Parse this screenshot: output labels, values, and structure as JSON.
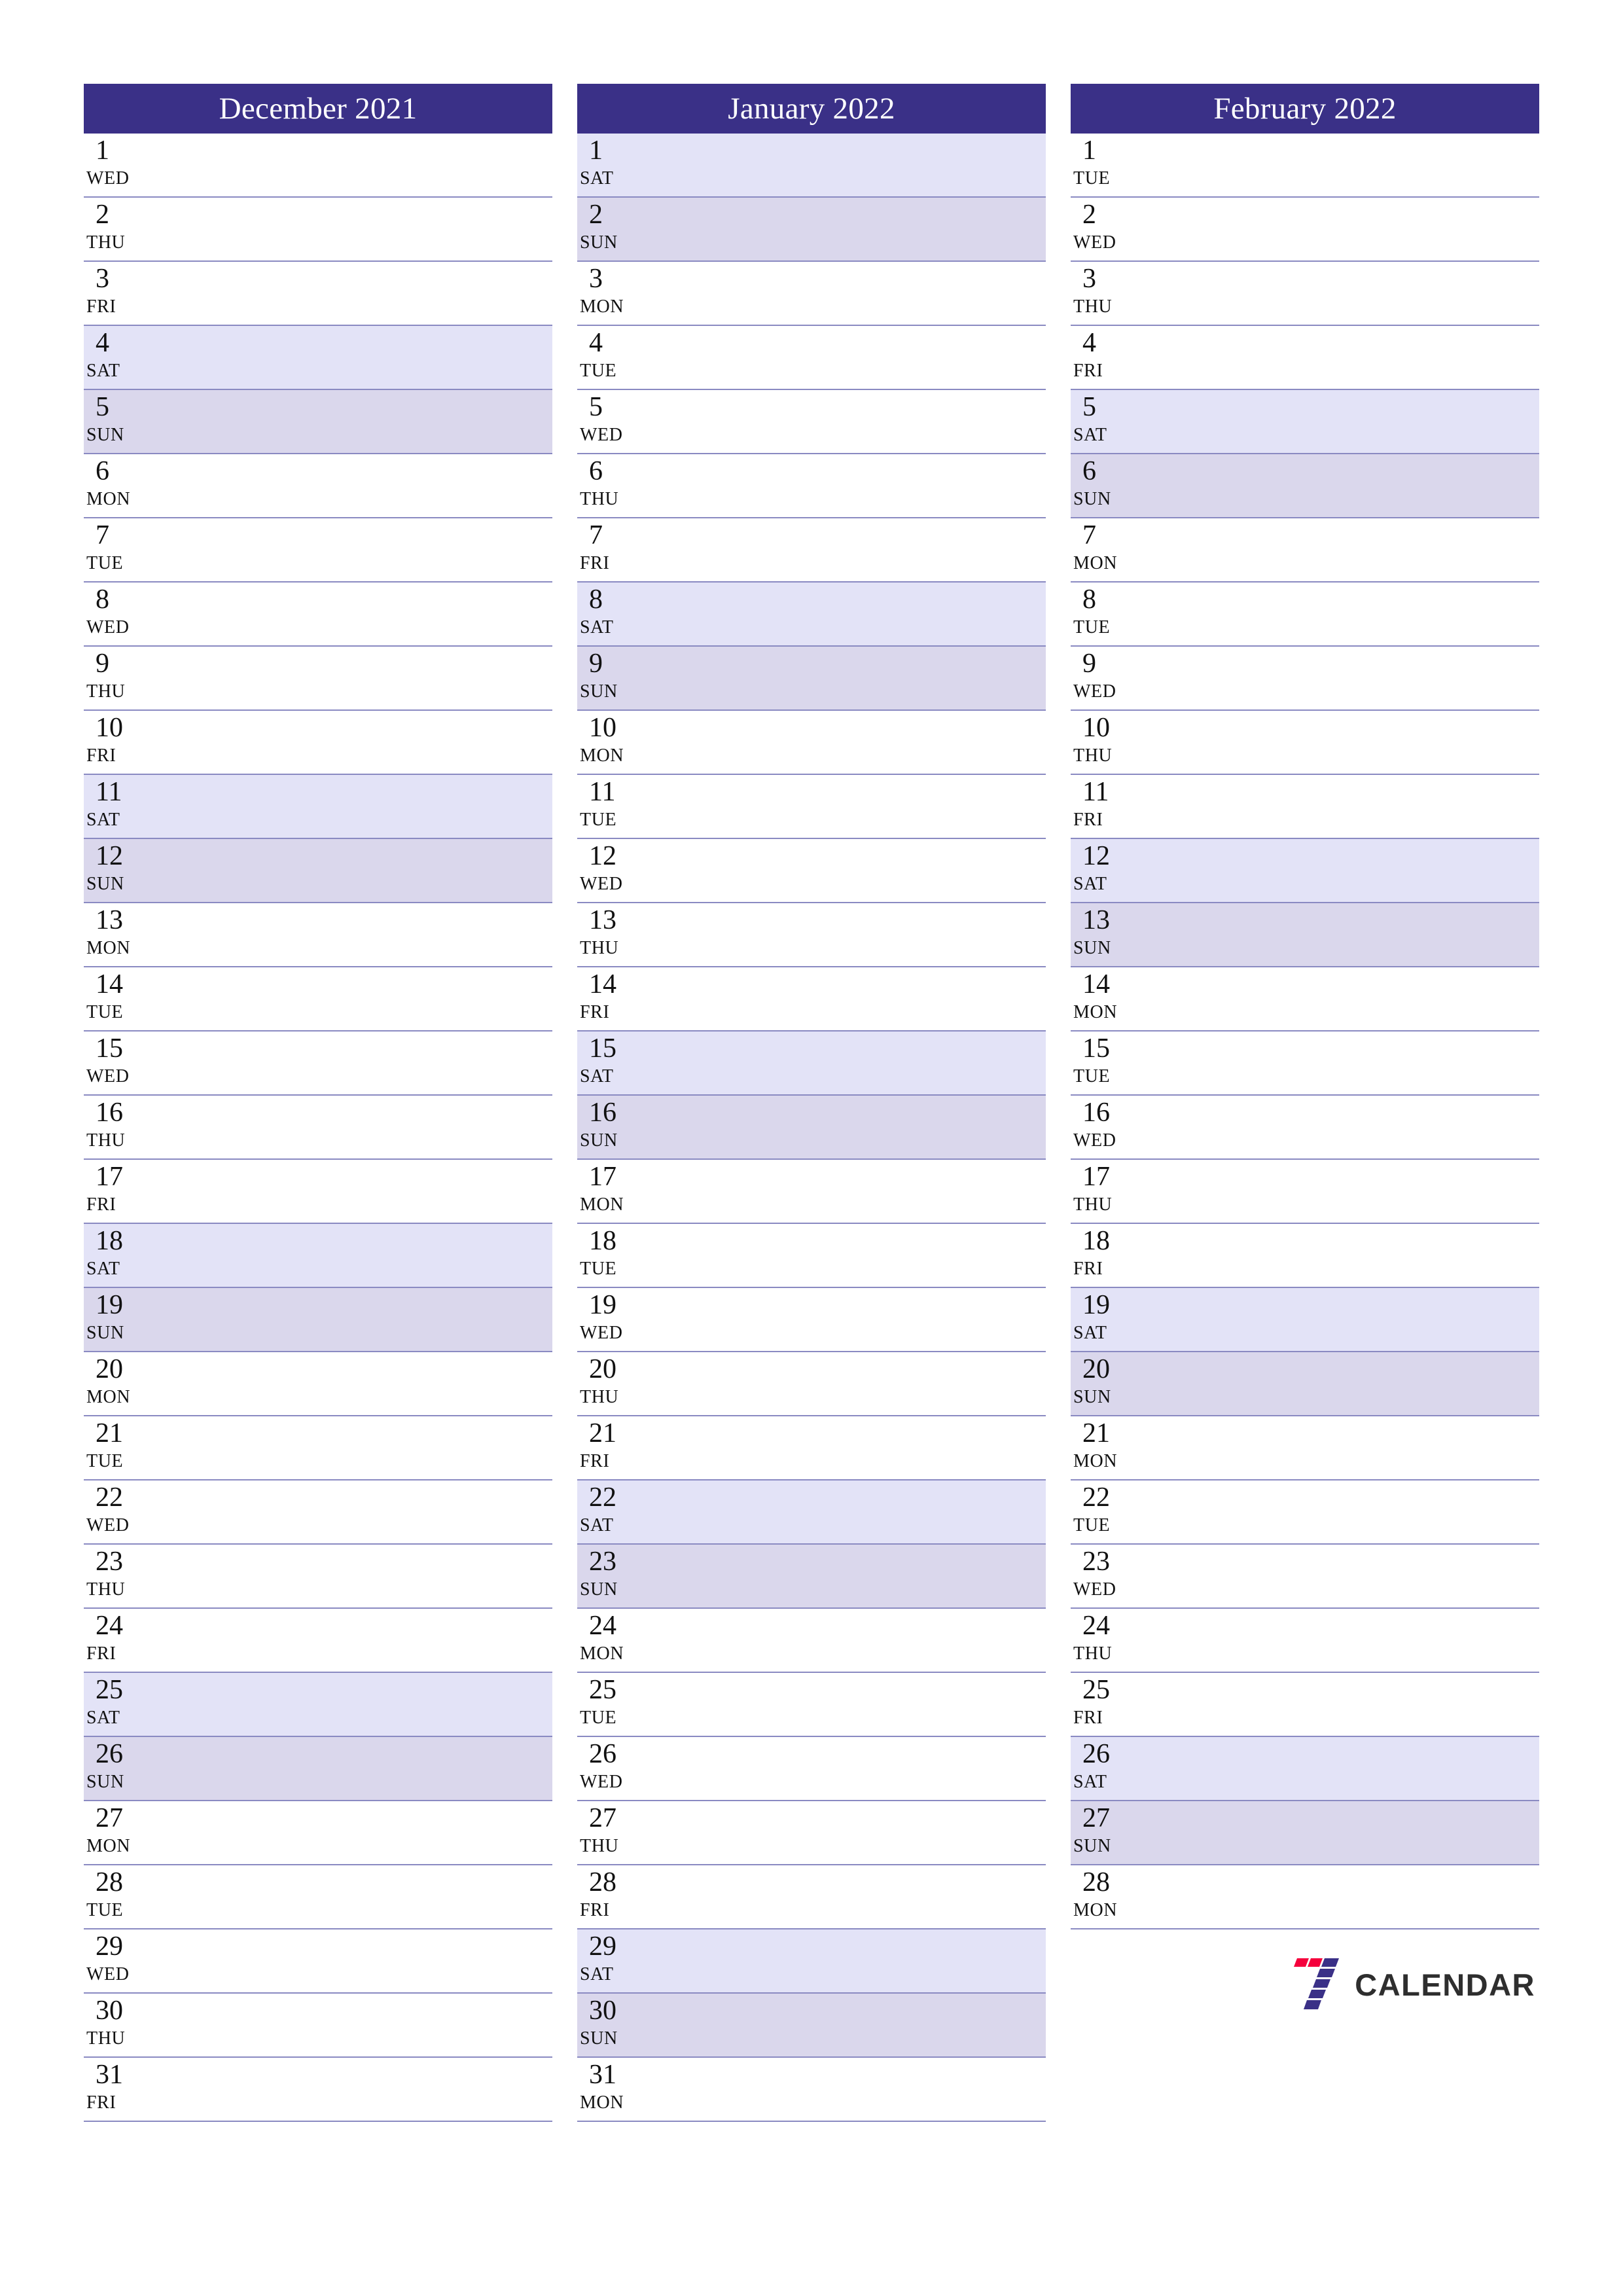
{
  "document": {
    "kind": "printable-calendar-planner",
    "orientation": "portrait",
    "colors": {
      "header_bg": "#3a3087",
      "header_text": "#ffffff",
      "saturday_bg": "#e3e3f7",
      "sunday_bg": "#dad7ec",
      "row_divider": "#8a8ac2",
      "page_bg": "#ffffff",
      "day_text": "#111111",
      "logo_red": "#f5003c",
      "logo_indigo": "#3a3087",
      "logo_wordmark": "#2e2e2e"
    }
  },
  "months": [
    {
      "title": "December 2021",
      "days": [
        {
          "num": "1",
          "weekday": "WED"
        },
        {
          "num": "2",
          "weekday": "THU"
        },
        {
          "num": "3",
          "weekday": "FRI"
        },
        {
          "num": "4",
          "weekday": "SAT"
        },
        {
          "num": "5",
          "weekday": "SUN"
        },
        {
          "num": "6",
          "weekday": "MON"
        },
        {
          "num": "7",
          "weekday": "TUE"
        },
        {
          "num": "8",
          "weekday": "WED"
        },
        {
          "num": "9",
          "weekday": "THU"
        },
        {
          "num": "10",
          "weekday": "FRI"
        },
        {
          "num": "11",
          "weekday": "SAT"
        },
        {
          "num": "12",
          "weekday": "SUN"
        },
        {
          "num": "13",
          "weekday": "MON"
        },
        {
          "num": "14",
          "weekday": "TUE"
        },
        {
          "num": "15",
          "weekday": "WED"
        },
        {
          "num": "16",
          "weekday": "THU"
        },
        {
          "num": "17",
          "weekday": "FRI"
        },
        {
          "num": "18",
          "weekday": "SAT"
        },
        {
          "num": "19",
          "weekday": "SUN"
        },
        {
          "num": "20",
          "weekday": "MON"
        },
        {
          "num": "21",
          "weekday": "TUE"
        },
        {
          "num": "22",
          "weekday": "WED"
        },
        {
          "num": "23",
          "weekday": "THU"
        },
        {
          "num": "24",
          "weekday": "FRI"
        },
        {
          "num": "25",
          "weekday": "SAT"
        },
        {
          "num": "26",
          "weekday": "SUN"
        },
        {
          "num": "27",
          "weekday": "MON"
        },
        {
          "num": "28",
          "weekday": "TUE"
        },
        {
          "num": "29",
          "weekday": "WED"
        },
        {
          "num": "30",
          "weekday": "THU"
        },
        {
          "num": "31",
          "weekday": "FRI"
        }
      ]
    },
    {
      "title": "January 2022",
      "days": [
        {
          "num": "1",
          "weekday": "SAT"
        },
        {
          "num": "2",
          "weekday": "SUN"
        },
        {
          "num": "3",
          "weekday": "MON"
        },
        {
          "num": "4",
          "weekday": "TUE"
        },
        {
          "num": "5",
          "weekday": "WED"
        },
        {
          "num": "6",
          "weekday": "THU"
        },
        {
          "num": "7",
          "weekday": "FRI"
        },
        {
          "num": "8",
          "weekday": "SAT"
        },
        {
          "num": "9",
          "weekday": "SUN"
        },
        {
          "num": "10",
          "weekday": "MON"
        },
        {
          "num": "11",
          "weekday": "TUE"
        },
        {
          "num": "12",
          "weekday": "WED"
        },
        {
          "num": "13",
          "weekday": "THU"
        },
        {
          "num": "14",
          "weekday": "FRI"
        },
        {
          "num": "15",
          "weekday": "SAT"
        },
        {
          "num": "16",
          "weekday": "SUN"
        },
        {
          "num": "17",
          "weekday": "MON"
        },
        {
          "num": "18",
          "weekday": "TUE"
        },
        {
          "num": "19",
          "weekday": "WED"
        },
        {
          "num": "20",
          "weekday": "THU"
        },
        {
          "num": "21",
          "weekday": "FRI"
        },
        {
          "num": "22",
          "weekday": "SAT"
        },
        {
          "num": "23",
          "weekday": "SUN"
        },
        {
          "num": "24",
          "weekday": "MON"
        },
        {
          "num": "25",
          "weekday": "TUE"
        },
        {
          "num": "26",
          "weekday": "WED"
        },
        {
          "num": "27",
          "weekday": "THU"
        },
        {
          "num": "28",
          "weekday": "FRI"
        },
        {
          "num": "29",
          "weekday": "SAT"
        },
        {
          "num": "30",
          "weekday": "SUN"
        },
        {
          "num": "31",
          "weekday": "MON"
        }
      ]
    },
    {
      "title": "February 2022",
      "days": [
        {
          "num": "1",
          "weekday": "TUE"
        },
        {
          "num": "2",
          "weekday": "WED"
        },
        {
          "num": "3",
          "weekday": "THU"
        },
        {
          "num": "4",
          "weekday": "FRI"
        },
        {
          "num": "5",
          "weekday": "SAT"
        },
        {
          "num": "6",
          "weekday": "SUN"
        },
        {
          "num": "7",
          "weekday": "MON"
        },
        {
          "num": "8",
          "weekday": "TUE"
        },
        {
          "num": "9",
          "weekday": "WED"
        },
        {
          "num": "10",
          "weekday": "THU"
        },
        {
          "num": "11",
          "weekday": "FRI"
        },
        {
          "num": "12",
          "weekday": "SAT"
        },
        {
          "num": "13",
          "weekday": "SUN"
        },
        {
          "num": "14",
          "weekday": "MON"
        },
        {
          "num": "15",
          "weekday": "TUE"
        },
        {
          "num": "16",
          "weekday": "WED"
        },
        {
          "num": "17",
          "weekday": "THU"
        },
        {
          "num": "18",
          "weekday": "FRI"
        },
        {
          "num": "19",
          "weekday": "SAT"
        },
        {
          "num": "20",
          "weekday": "SUN"
        },
        {
          "num": "21",
          "weekday": "MON"
        },
        {
          "num": "22",
          "weekday": "TUE"
        },
        {
          "num": "23",
          "weekday": "WED"
        },
        {
          "num": "24",
          "weekday": "THU"
        },
        {
          "num": "25",
          "weekday": "FRI"
        },
        {
          "num": "26",
          "weekday": "SAT"
        },
        {
          "num": "27",
          "weekday": "SUN"
        },
        {
          "num": "28",
          "weekday": "MON"
        }
      ]
    }
  ],
  "logo": {
    "mark_icon": "seven-logo-icon",
    "wordmark": "CALENDAR"
  }
}
